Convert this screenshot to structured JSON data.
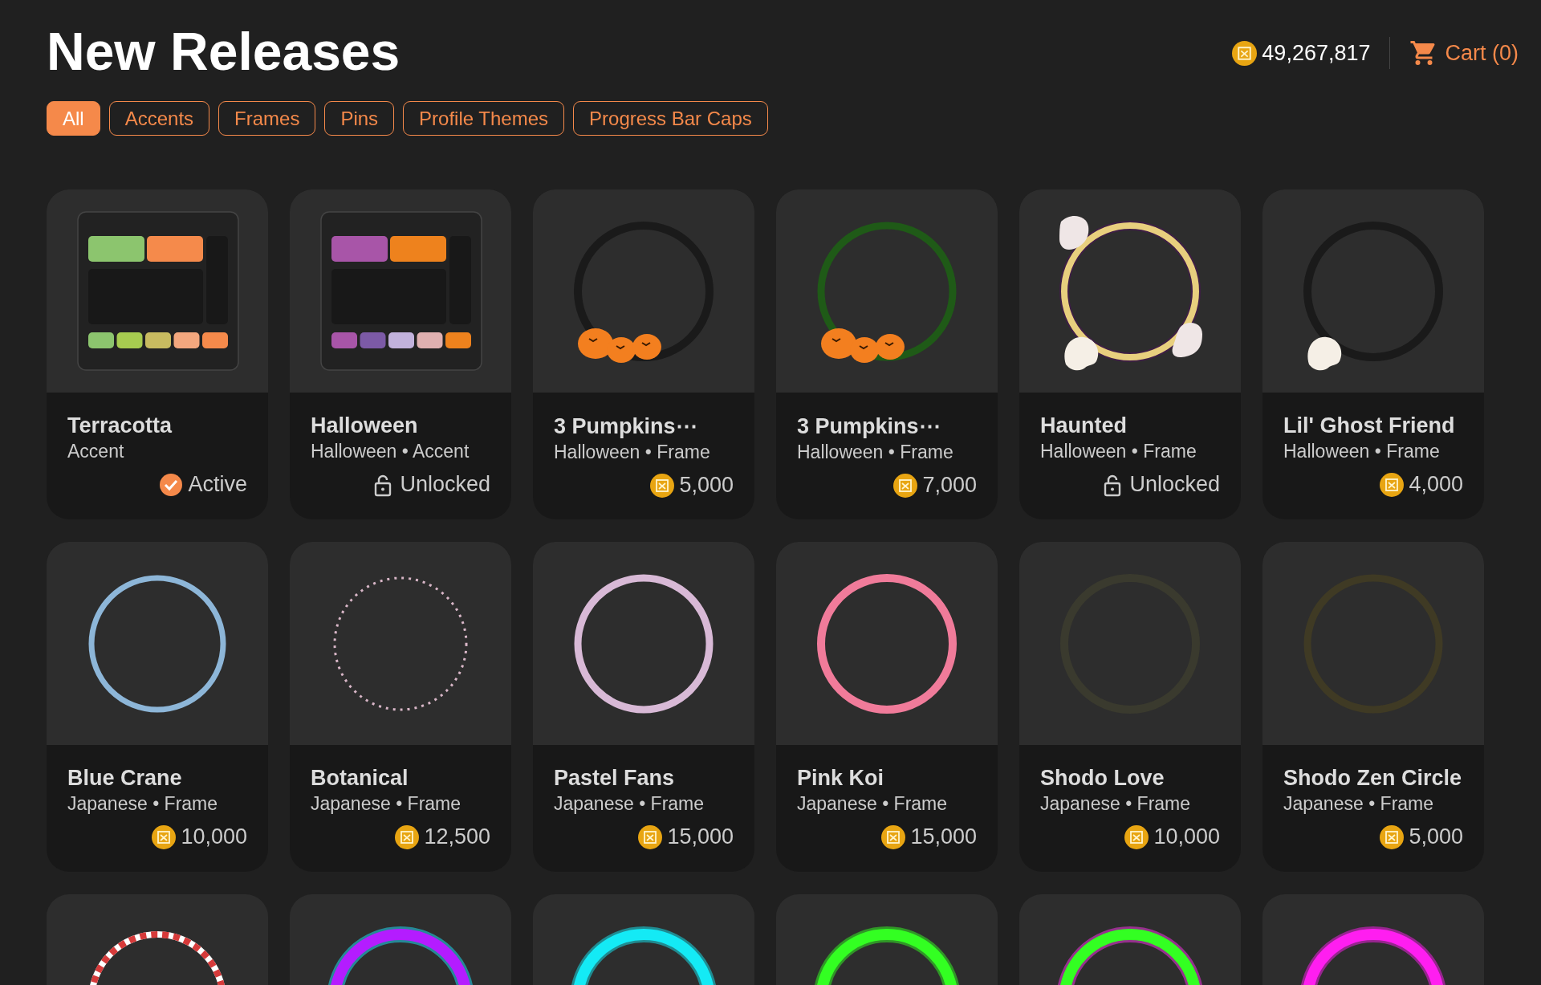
{
  "title": "New Releases",
  "balance": "49,267,817",
  "cart": "Cart (0)",
  "tabs": [
    {
      "label": "All",
      "selected": true
    },
    {
      "label": "Accents",
      "selected": false
    },
    {
      "label": "Frames",
      "selected": false
    },
    {
      "label": "Pins",
      "selected": false
    },
    {
      "label": "Profile Themes",
      "selected": false
    },
    {
      "label": "Progress Bar Caps",
      "selected": false
    }
  ],
  "cards": [
    {
      "name": "Terracotta",
      "subtitle": "Accent",
      "kind": "active",
      "status": "Active"
    },
    {
      "name": "Halloween",
      "subtitle": "Halloween • Accent",
      "kind": "unlocked",
      "status": "Unlocked"
    },
    {
      "name": "3 Pumpkins⋯",
      "subtitle": "Halloween • Frame",
      "kind": "price",
      "status": "5,000"
    },
    {
      "name": "3 Pumpkins⋯",
      "subtitle": "Halloween • Frame",
      "kind": "price",
      "status": "7,000"
    },
    {
      "name": "Haunted",
      "subtitle": "Halloween • Frame",
      "kind": "unlocked",
      "status": "Unlocked"
    },
    {
      "name": "Lil' Ghost Friend",
      "subtitle": "Halloween • Frame",
      "kind": "price",
      "status": "4,000"
    },
    {
      "name": "Blue Crane",
      "subtitle": "Japanese • Frame",
      "kind": "price",
      "status": "10,000"
    },
    {
      "name": "Botanical",
      "subtitle": "Japanese • Frame",
      "kind": "price",
      "status": "12,500"
    },
    {
      "name": "Pastel Fans",
      "subtitle": "Japanese • Frame",
      "kind": "price",
      "status": "15,000"
    },
    {
      "name": "Pink Koi",
      "subtitle": "Japanese • Frame",
      "kind": "price",
      "status": "15,000"
    },
    {
      "name": "Shodo Love",
      "subtitle": "Japanese • Frame",
      "kind": "price",
      "status": "10,000"
    },
    {
      "name": "Shodo Zen Circle",
      "subtitle": "Japanese • Frame",
      "kind": "price",
      "status": "5,000"
    }
  ]
}
